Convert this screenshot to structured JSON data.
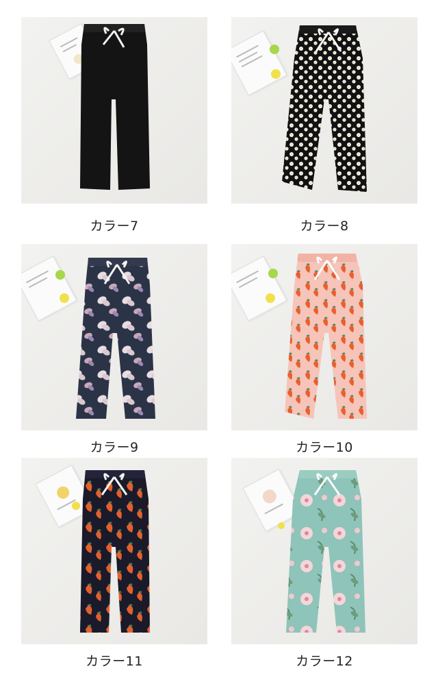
{
  "items": [
    {
      "caption": "カラー7",
      "pattern": "solid-black",
      "base_color": "#141414"
    },
    {
      "caption": "カラー8",
      "pattern": "daisy-on-black",
      "base_color": "#121212"
    },
    {
      "caption": "カラー9",
      "pattern": "butterfly-on-navy",
      "base_color": "#2b3347"
    },
    {
      "caption": "カラー10",
      "pattern": "strawberry-on-pink",
      "base_color": "#f6c4b8"
    },
    {
      "caption": "カラー11",
      "pattern": "strawberry-on-navy",
      "base_color": "#1a1a2a"
    },
    {
      "caption": "カラー12",
      "pattern": "flower-on-mint",
      "base_color": "#8ec4b9"
    }
  ]
}
